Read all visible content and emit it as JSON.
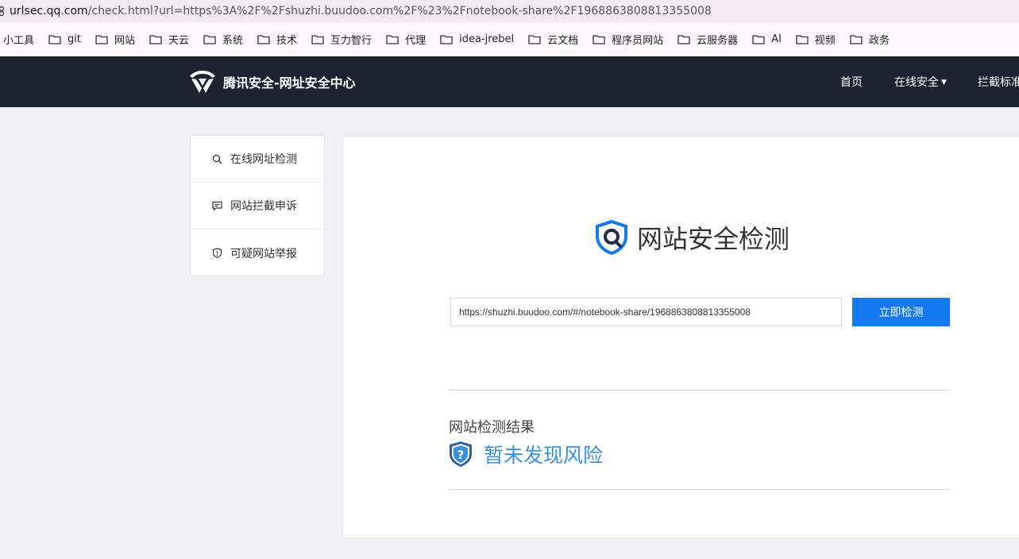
{
  "browser": {
    "url_host": "urlsec.qq.com",
    "url_rest": "/check.html?url=https%3A%2F%2Fshuzhi.buudoo.com%2F%23%2Fnotebook-share%2F1968863808813355008",
    "bookmarks": [
      {
        "label": "小工具",
        "folder": false
      },
      {
        "label": "git",
        "folder": true
      },
      {
        "label": "网站",
        "folder": true
      },
      {
        "label": "天云",
        "folder": true
      },
      {
        "label": "系统",
        "folder": true
      },
      {
        "label": "技术",
        "folder": true
      },
      {
        "label": "互力智行",
        "folder": true
      },
      {
        "label": "代理",
        "folder": true
      },
      {
        "label": "idea-jrebel",
        "folder": true
      },
      {
        "label": "云文档",
        "folder": true
      },
      {
        "label": "程序员网站",
        "folder": true
      },
      {
        "label": "云服务器",
        "folder": true
      },
      {
        "label": "AI",
        "folder": true
      },
      {
        "label": "视频",
        "folder": true
      },
      {
        "label": "政务",
        "folder": true
      }
    ]
  },
  "header": {
    "logo_text": "腾讯安全-网址安全中心",
    "nav": {
      "home": "首页",
      "online_security": "在线安全",
      "block_standard": "拦截标准"
    }
  },
  "sidebar": {
    "items": [
      {
        "label": "在线网址检测",
        "icon": "search-icon"
      },
      {
        "label": "网站拦截申诉",
        "icon": "chat-icon"
      },
      {
        "label": "可疑网站举报",
        "icon": "shield-icon"
      }
    ]
  },
  "main": {
    "title": "网站安全检测",
    "url_value": "https://shuzhi.buudoo.com/#/notebook-share/1968863808813355008",
    "check_button": "立即检测",
    "result_label": "网站检测结果",
    "result_text": "暂未发现风险"
  },
  "colors": {
    "nav_bg": "#1f2330",
    "accent": "#1479f0",
    "result": "#3a8ee6"
  }
}
